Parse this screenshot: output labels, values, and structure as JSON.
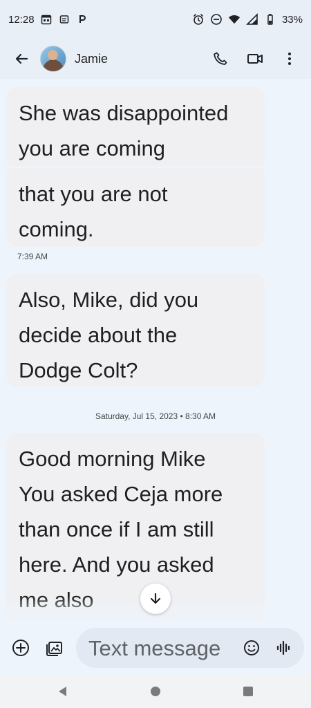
{
  "status_bar": {
    "time": "12:28",
    "battery": "33%",
    "icons": [
      "calendar-icon",
      "notification-icon",
      "p-icon",
      "alarm-icon",
      "dnd-icon",
      "wifi-icon",
      "signal-icon",
      "battery-icon"
    ]
  },
  "header": {
    "contact_name": "Jamie",
    "back_icon": "arrow-left-icon",
    "call_icon": "phone-icon",
    "video_icon": "video-icon",
    "menu_icon": "more-vert-icon"
  },
  "messages": [
    {
      "lines": [
        "She was disappointed",
        "you are coming"
      ]
    },
    {
      "lines": [
        "that you are not",
        "coming."
      ]
    },
    {
      "time": "7:39 AM"
    },
    {
      "lines": [
        "Also, Mike, did you",
        "decide about the",
        "Dodge Colt?"
      ]
    },
    {
      "date_separator": "Saturday, Jul 15, 2023 • 8:30 AM"
    },
    {
      "lines": [
        "Good morning Mike",
        "",
        "You asked Ceja more",
        "than once if I am still",
        "here. And you asked",
        "me also"
      ]
    }
  ],
  "composer": {
    "placeholder": "Text message",
    "add_icon": "add-circle-icon",
    "gallery_icon": "gallery-icon",
    "emoji_icon": "emoji-icon",
    "voice_icon": "voice-waveform-icon"
  },
  "navigation": {
    "back_icon": "nav-back-icon",
    "home_icon": "nav-home-icon",
    "recents_icon": "nav-recents-icon"
  },
  "colors": {
    "background": "#eef4fb",
    "bubble": "#f0f0f2",
    "header": "#e9eff7",
    "input": "#e2e9f3"
  }
}
